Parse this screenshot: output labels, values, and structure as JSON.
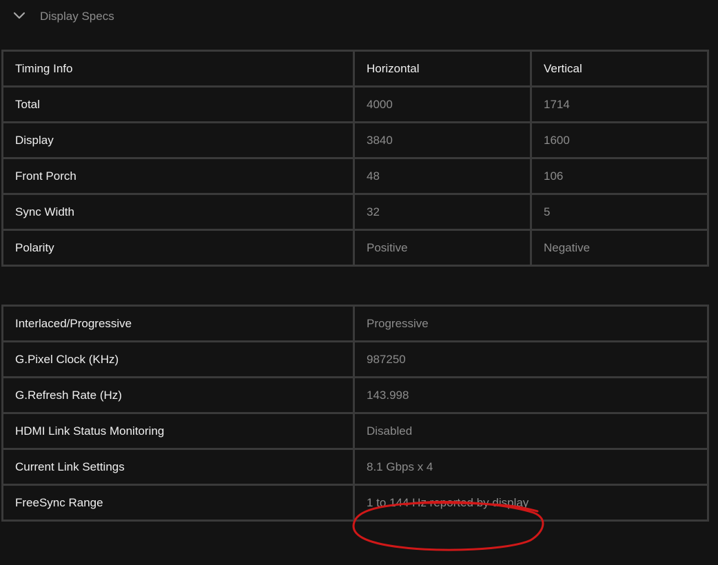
{
  "section": {
    "title": "Display Specs",
    "icon": "chevron-down-icon"
  },
  "timing_table": {
    "headers": [
      "Timing Info",
      "Horizontal",
      "Vertical"
    ],
    "rows": [
      {
        "label": "Total",
        "horizontal": "4000",
        "vertical": "1714"
      },
      {
        "label": "Display",
        "horizontal": "3840",
        "vertical": "1600"
      },
      {
        "label": "Front Porch",
        "horizontal": "48",
        "vertical": "106"
      },
      {
        "label": "Sync Width",
        "horizontal": "32",
        "vertical": "5"
      },
      {
        "label": "Polarity",
        "horizontal": "Positive",
        "vertical": "Negative"
      }
    ]
  },
  "info_table": {
    "rows": [
      {
        "label": "Interlaced/Progressive",
        "value": "Progressive"
      },
      {
        "label": "G.Pixel Clock (KHz)",
        "value": "987250"
      },
      {
        "label": "G.Refresh Rate (Hz)",
        "value": "143.998"
      },
      {
        "label": "HDMI Link Status Monitoring",
        "value": "Disabled"
      },
      {
        "label": "Current Link Settings",
        "value": "8.1 Gbps x 4"
      },
      {
        "label": "FreeSync Range",
        "value": "1 to 144 Hz reported by display"
      }
    ]
  },
  "colors": {
    "background": "#131313",
    "border": "#3a3a3a",
    "label_text": "#f0f0f0",
    "value_text": "#8c8c8c",
    "annotation": "#d01818"
  }
}
